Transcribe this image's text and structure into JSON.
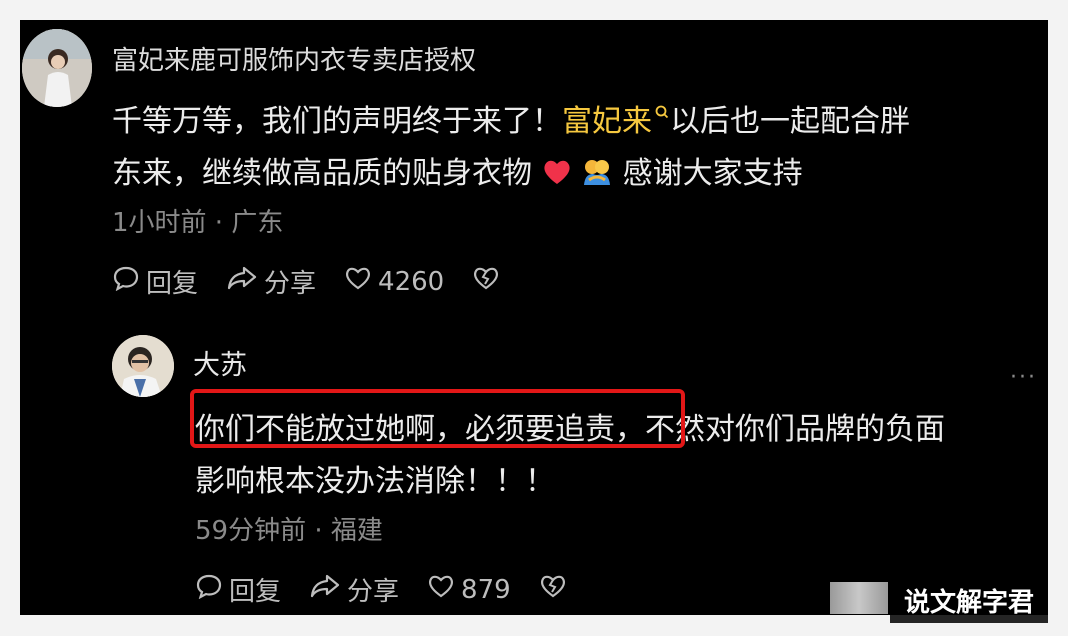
{
  "comment": {
    "author": "富妃来鹿可服饰内衣专卖店授权",
    "text_line1_pre": "千等万等，我们的声明终于来了！",
    "link_text": "富妃来",
    "text_line1_post": "以后也一起配合胖",
    "text_line2_pre": "东来，继续做高品质的贴身衣物",
    "text_line2_post": "感谢大家支持",
    "meta": "1小时前 · 广东",
    "reply_label": "回复",
    "share_label": "分享",
    "like_count": "4260"
  },
  "reply": {
    "author": "大苏",
    "text_line1_highlight": "你们不能放过她啊，必须要追责，",
    "text_line1_rest": "不然对你们品牌的负面",
    "text_line2": "影响根本没办法消除！！！",
    "meta": "59分钟前 · 福建",
    "reply_label": "回复",
    "share_label": "分享",
    "like_count": "879",
    "more_label": "···"
  },
  "watermark": "说文解字君",
  "colors": {
    "link": "#f6c83f",
    "highlight_border": "#e21717",
    "heart": "#f0324a"
  }
}
